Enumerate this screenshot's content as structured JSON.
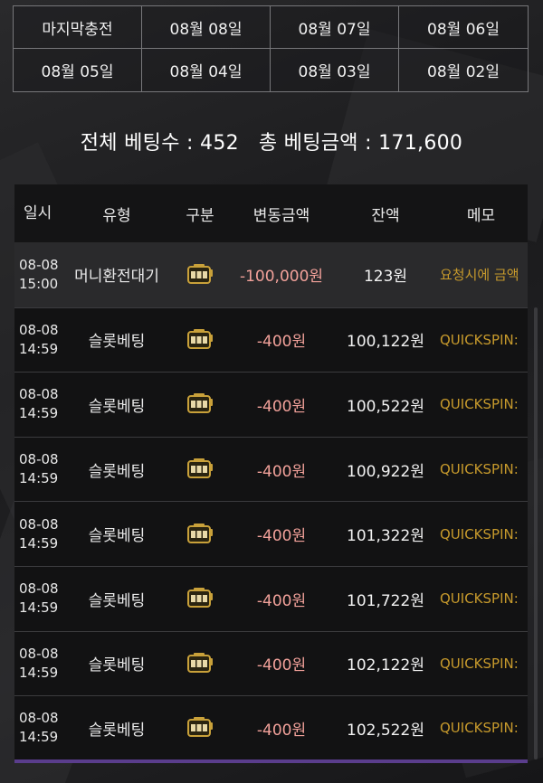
{
  "date_tabs": [
    "마지막충전",
    "08월 08일",
    "08월 07일",
    "08월 06일",
    "08월 05일",
    "08월 04일",
    "08월 03일",
    "08월 02일"
  ],
  "summary": {
    "count_label": "전체 베팅수 : 452",
    "amount_label": "총 베팅금액 : 171,600"
  },
  "table": {
    "headers": [
      "일시",
      "유형",
      "구분",
      "변동금액",
      "잔액",
      "메모"
    ],
    "rows": [
      {
        "date": "08-08",
        "time": "15:00",
        "type": "머니환전대기",
        "icon": "slot-machine-icon",
        "change": "-100,000원",
        "balance": "123원",
        "memo": "요청시에 금액"
      },
      {
        "date": "08-08",
        "time": "14:59",
        "type": "슬롯베팅",
        "icon": "slot-machine-icon",
        "change": "-400원",
        "balance": "100,122원",
        "memo": "QUICKSPIN:"
      },
      {
        "date": "08-08",
        "time": "14:59",
        "type": "슬롯베팅",
        "icon": "slot-machine-icon",
        "change": "-400원",
        "balance": "100,522원",
        "memo": "QUICKSPIN:"
      },
      {
        "date": "08-08",
        "time": "14:59",
        "type": "슬롯베팅",
        "icon": "slot-machine-icon",
        "change": "-400원",
        "balance": "100,922원",
        "memo": "QUICKSPIN:"
      },
      {
        "date": "08-08",
        "time": "14:59",
        "type": "슬롯베팅",
        "icon": "slot-machine-icon",
        "change": "-400원",
        "balance": "101,322원",
        "memo": "QUICKSPIN:"
      },
      {
        "date": "08-08",
        "time": "14:59",
        "type": "슬롯베팅",
        "icon": "slot-machine-icon",
        "change": "-400원",
        "balance": "101,722원",
        "memo": "QUICKSPIN:"
      },
      {
        "date": "08-08",
        "time": "14:59",
        "type": "슬롯베팅",
        "icon": "slot-machine-icon",
        "change": "-400원",
        "balance": "102,122원",
        "memo": "QUICKSPIN:"
      },
      {
        "date": "08-08",
        "time": "14:59",
        "type": "슬롯베팅",
        "icon": "slot-machine-icon",
        "change": "-400원",
        "balance": "102,522원",
        "memo": "QUICKSPIN:"
      }
    ]
  },
  "colors": {
    "negative": "#f2a19a",
    "memo": "#c79a2c",
    "accent_bar": "#5a3d8c"
  }
}
